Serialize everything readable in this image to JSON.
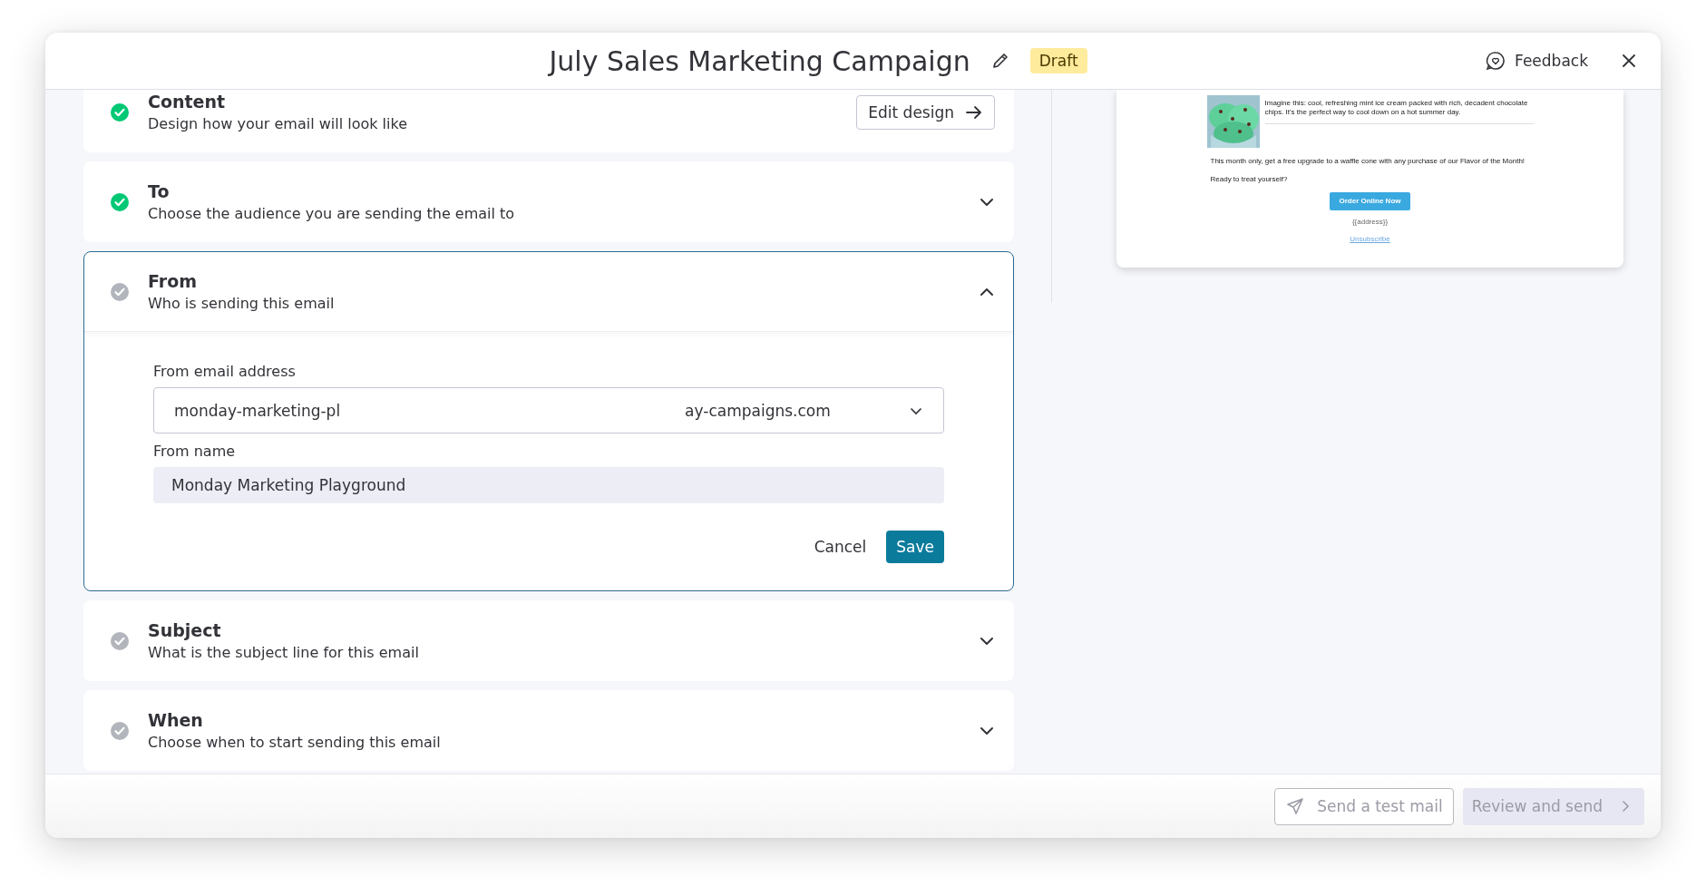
{
  "header": {
    "title": "July Sales Marketing Campaign",
    "status": "Draft",
    "feedback": "Feedback"
  },
  "steps": [
    {
      "kind": "action",
      "title": "Content",
      "subtitle": "Design how your email will look like",
      "done": true,
      "action": "Edit design"
    },
    {
      "kind": "collapsible",
      "title": "To",
      "subtitle": "Choose the audience you are sending the email to",
      "done": true,
      "expanded": false
    },
    {
      "kind": "collapsible",
      "title": "From",
      "subtitle": "Who is sending this email",
      "done": false,
      "expanded": true,
      "form": {
        "email_label": "From email address",
        "email_value_start": "monday-marketing-pl",
        "email_value_end": "ay-campaigns.com",
        "name_label": "From name",
        "name_value": "Monday Marketing Playground",
        "cancel": "Cancel",
        "save": "Save"
      }
    },
    {
      "kind": "collapsible",
      "title": "Subject",
      "subtitle": "What is the subject line for this email",
      "done": false,
      "expanded": false
    },
    {
      "kind": "collapsible",
      "title": "When",
      "subtitle": "Choose when to start sending this email",
      "done": false,
      "expanded": false
    }
  ],
  "preview": {
    "intro": "Imagine this: cool, refreshing mint ice cream packed with rich, decadent chocolate chips. It's the perfect way to cool down on a hot summer day.",
    "offer": "This month only, get a free upgrade to a waffle cone with any purchase of our Flavor of the Month!",
    "question": "Ready to treat yourself?",
    "button": "Order Online Now",
    "address": "{{address}}",
    "unsubscribe": "Unsubscribe"
  },
  "footer": {
    "test": "Send a test mail",
    "review": "Review and send"
  }
}
